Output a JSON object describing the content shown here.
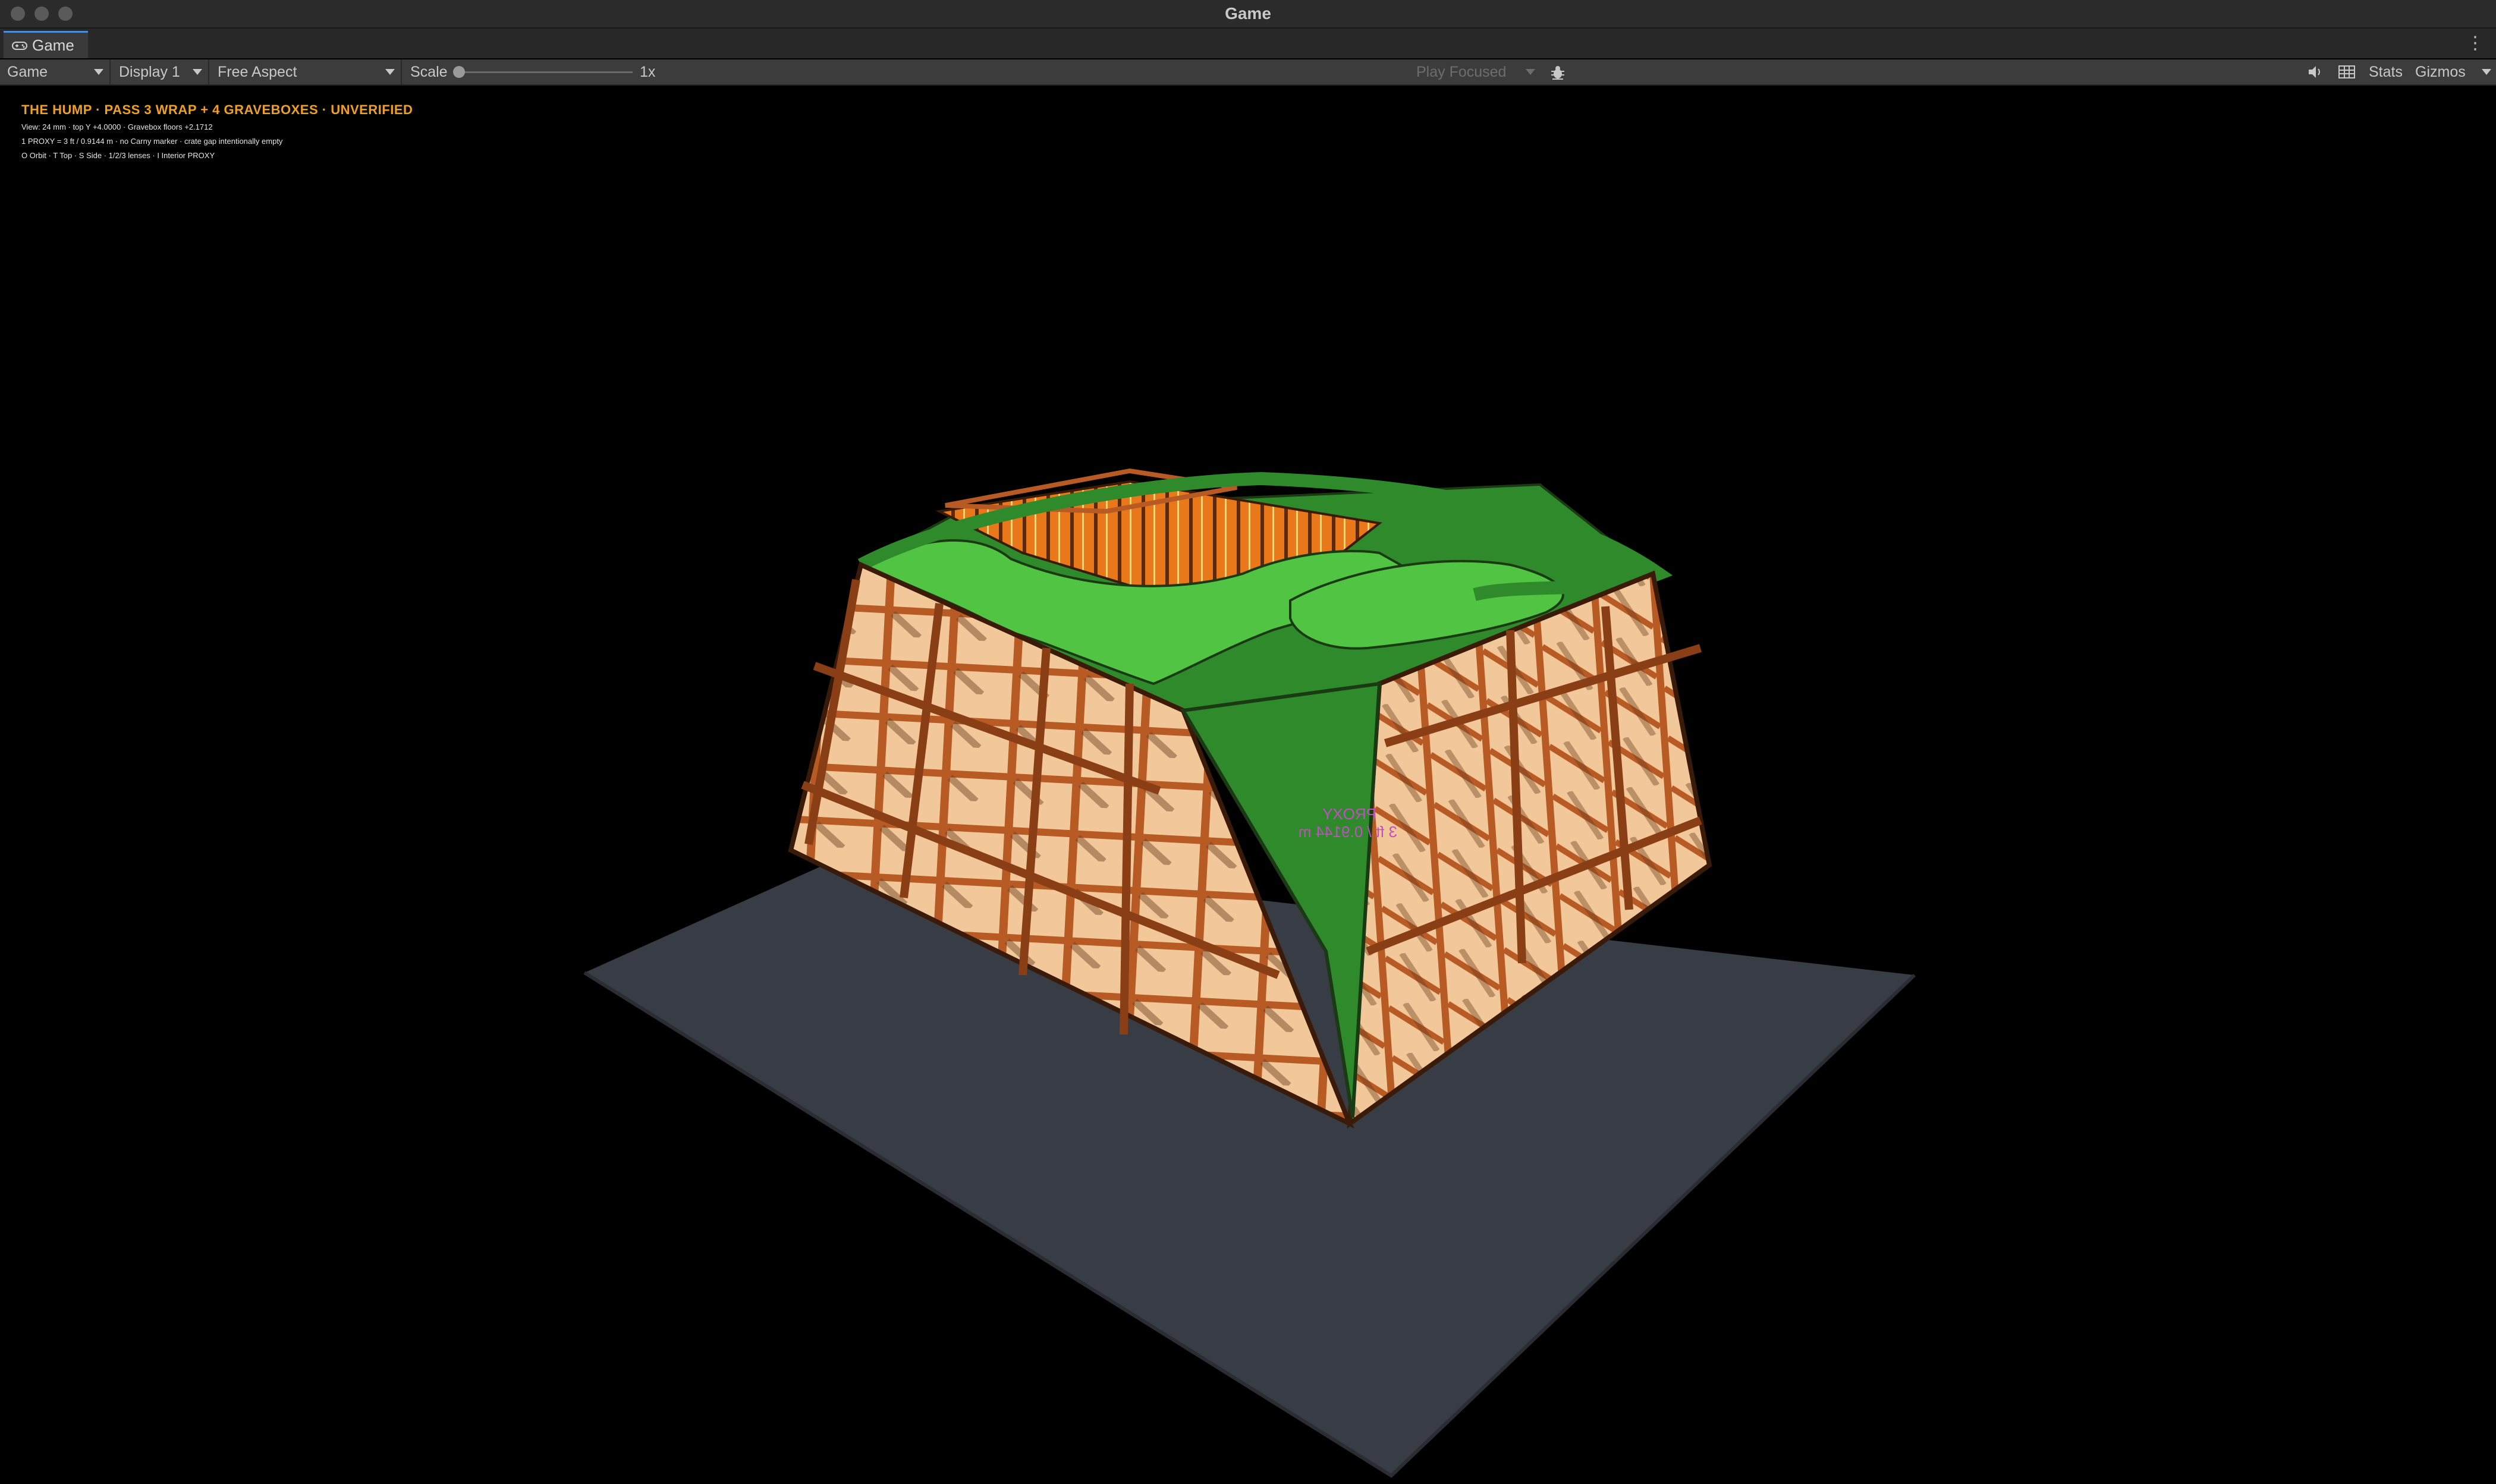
{
  "window": {
    "title": "Game"
  },
  "tab": {
    "label": "Game",
    "icon": "gamepad-icon",
    "more_icon": "kebab-menu-icon"
  },
  "toolbar": {
    "view_dropdown": "Game",
    "display_dropdown": "Display 1",
    "aspect_dropdown": "Free Aspect",
    "scale_label": "Scale",
    "scale_value": "1x",
    "scale_level": 0,
    "play_mode_dropdown": "Play Focused",
    "bug_icon": "bug-icon",
    "audio_icon": "speaker-icon",
    "grid_icon": "keyboard-grid-icon",
    "stats_label": "Stats",
    "gizmos_label": "Gizmos"
  },
  "hud": {
    "title": "THE HUMP · PASS 3 WRAP + 4 GRAVEBOXES · UNVERIFIED",
    "line1": "View: 24 mm · top Y +4.0000 · Gravebox floors +2.1712",
    "line2": "1 PROXY = 3 ft / 0.9144 m · no Carny marker · crate gap intentionally empty",
    "line3": "O Orbit · T Top · S Side · 1/2/3 lenses · I Interior PROXY"
  },
  "scene": {
    "proxy_line1": "PROXY",
    "proxy_line2": "3 ft / 0.9144 m",
    "colors": {
      "ground": "#383c44",
      "wall_panel": "#f2c89a",
      "beam": "#b85a24",
      "outline": "#3a1a08",
      "roof_dark": "#2f8a2c",
      "roof_light": "#52c444",
      "proxy": "#c050c0",
      "hud_title": "#f0a020"
    }
  }
}
